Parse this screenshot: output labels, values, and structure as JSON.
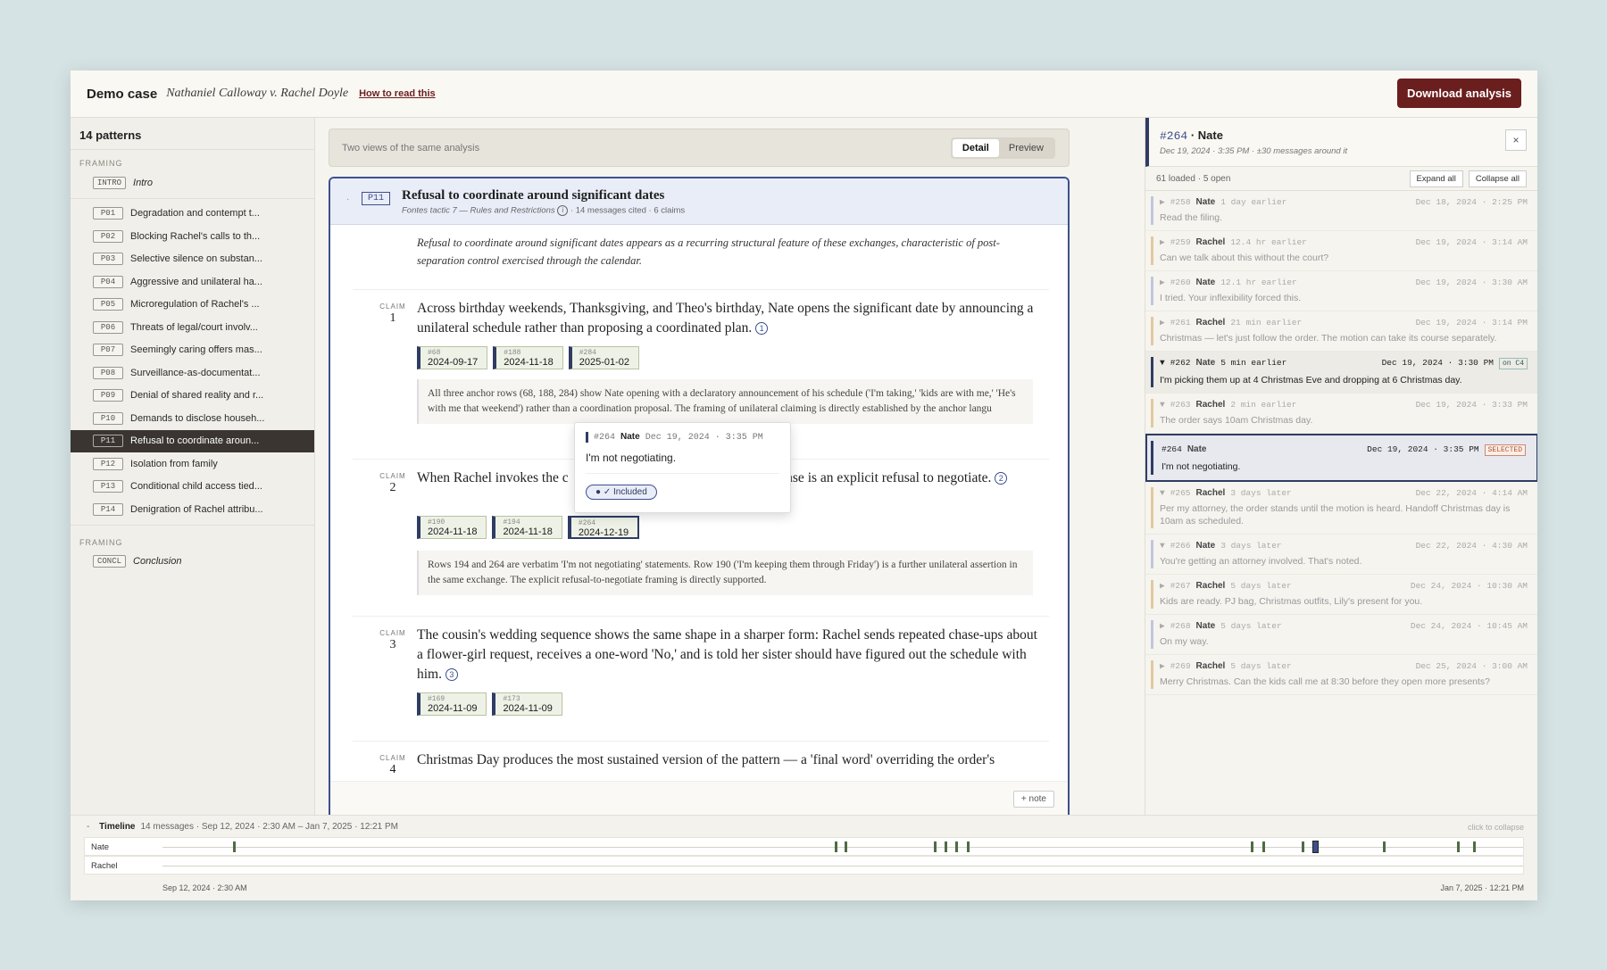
{
  "header": {
    "title": "Demo case",
    "case_name": "Nathaniel Calloway v. Rachel Doyle",
    "how_link": "How to read this",
    "download": "Download analysis"
  },
  "sidebar": {
    "count": "14 patterns",
    "section_top": "FRAMING",
    "section_bottom": "FRAMING",
    "intro": {
      "code": "INTRO",
      "label": "Intro"
    },
    "items": [
      {
        "code": "P01",
        "label": "Degradation and contempt t..."
      },
      {
        "code": "P02",
        "label": "Blocking Rachel's calls to th..."
      },
      {
        "code": "P03",
        "label": "Selective silence on substan..."
      },
      {
        "code": "P04",
        "label": "Aggressive and unilateral ha..."
      },
      {
        "code": "P05",
        "label": "Microregulation of Rachel's ..."
      },
      {
        "code": "P06",
        "label": "Threats of legal/court involv..."
      },
      {
        "code": "P07",
        "label": "Seemingly caring offers mas..."
      },
      {
        "code": "P08",
        "label": "Surveillance-as-documentat..."
      },
      {
        "code": "P09",
        "label": "Denial of shared reality and r..."
      },
      {
        "code": "P10",
        "label": "Demands to disclose househ..."
      },
      {
        "code": "P11",
        "label": "Refusal to coordinate aroun..."
      },
      {
        "code": "P12",
        "label": "Isolation from family"
      },
      {
        "code": "P13",
        "label": "Conditional child access tied..."
      },
      {
        "code": "P14",
        "label": "Denigration of Rachel attribu..."
      }
    ],
    "conclusion": {
      "code": "CONCL",
      "label": "Conclusion"
    }
  },
  "views": {
    "caption": "Two views of the same analysis",
    "detail": "Detail",
    "preview": "Preview"
  },
  "pattern": {
    "code": "P11",
    "title": "Refusal to coordinate around significant dates",
    "tactic": "Fontes tactic 7 — Rules and Restrictions",
    "stats": "· 14 messages cited · 6 claims",
    "intro": "Refusal to coordinate around significant dates appears as a recurring structural feature of these exchanges, characteristic of post-separation control exercised through the calendar.",
    "claim_label": "CLAIM",
    "add_note": "+ note",
    "claims": [
      {
        "num": "1",
        "text": "Across birthday weekends, Thanksgiving, and Theo's birthday, Nate opens the significant date by announcing a unilateral schedule rather than proposing a coordinated plan.",
        "marker": "1",
        "chips": [
          {
            "id": "#68",
            "date": "2024-09-17"
          },
          {
            "id": "#188",
            "date": "2024-11-18"
          },
          {
            "id": "#284",
            "date": "2025-01-02"
          }
        ],
        "note": "All three anchor rows (68, 188, 284) show Nate opening with a declaratory announcement of his schedule ('I'm taking,' 'kids are with me,' 'He's with me that weekend') rather than a coordination proposal. The framing of unilateral claiming is directly established by the anchor langu"
      },
      {
        "num": "2",
        "text_a": "When Rachel invokes the c",
        "text_b": "response is an explicit refusal to negotiate.",
        "marker": "2",
        "chips": [
          {
            "id": "#190",
            "date": "2024-11-18"
          },
          {
            "id": "#194",
            "date": "2024-11-18"
          },
          {
            "id": "#264",
            "date": "2024-12-19"
          }
        ],
        "note": "Rows 194 and 264 are verbatim 'I'm not negotiating' statements. Row 190 ('I'm keeping them through Friday') is a further unilateral assertion in the same exchange. The explicit refusal-to-negotiate framing is directly supported."
      },
      {
        "num": "3",
        "text": "The cousin's wedding sequence shows the same shape in a sharper form: Rachel sends repeated chase-ups about a flower-girl request, receives a one-word 'No,' and is told her sister should have figured out the schedule with him.",
        "marker": "3",
        "chips": [
          {
            "id": "#169",
            "date": "2024-11-09"
          },
          {
            "id": "#173",
            "date": "2024-11-09"
          }
        ]
      },
      {
        "num": "4",
        "text": "Christmas Day produces the most sustained version of the pattern — a 'final word' overriding the order's"
      }
    ]
  },
  "popover": {
    "id": "#264",
    "sender": "Nate",
    "ts": "Dec 19, 2024 · 3:35 PM",
    "text": "I'm not negotiating.",
    "status": "✓ Included"
  },
  "thread": {
    "id": "#264",
    "sender": "· Nate",
    "meta": "Dec 19, 2024 · 3:35 PM · ±30 messages around it",
    "close": "×",
    "loaded": "61 loaded · 5 open",
    "expand": "Expand all",
    "collapse": "Collapse all",
    "messages": [
      {
        "arrow": "▶",
        "id": "#258",
        "sender": "Nate",
        "rel": "1 day earlier",
        "ts": "Dec 18, 2024 · 2:25 PM",
        "text": "Read the filing.",
        "side": "n"
      },
      {
        "arrow": "▶",
        "id": "#259",
        "sender": "Rachel",
        "rel": "12.4 hr earlier",
        "ts": "Dec 19, 2024 · 3:14 AM",
        "text": "Can we talk about this without the court?",
        "side": "r"
      },
      {
        "arrow": "▶",
        "id": "#260",
        "sender": "Nate",
        "rel": "12.1 hr earlier",
        "ts": "Dec 19, 2024 · 3:30 AM",
        "text": "I tried. Your inflexibility forced this.",
        "side": "n"
      },
      {
        "arrow": "▶",
        "id": "#261",
        "sender": "Rachel",
        "rel": "21 min earlier",
        "ts": "Dec 19, 2024 · 3:14 PM",
        "text": "Christmas — let's just follow the order. The motion can take its course separately.",
        "side": "r"
      },
      {
        "arrow": "▼",
        "id": "#262",
        "sender": "Nate",
        "rel": "5 min earlier",
        "ts": "Dec 19, 2024 · 3:30 PM",
        "tag": "on C4",
        "text": "I'm picking them up at 4 Christmas Eve and dropping at 6 Christmas day.",
        "side": "n",
        "hi": true
      },
      {
        "arrow": "▼",
        "id": "#263",
        "sender": "Rachel",
        "rel": "2 min earlier",
        "ts": "Dec 19, 2024 · 3:33 PM",
        "text": "The order says 10am Christmas day.",
        "side": "r"
      },
      {
        "arrow": "",
        "id": "#264",
        "sender": "Nate",
        "rel": "",
        "ts": "Dec 19, 2024 · 3:35 PM",
        "tag": "SELECTED",
        "text": "I'm not negotiating.",
        "side": "n",
        "sel": true
      },
      {
        "arrow": "▼",
        "id": "#265",
        "sender": "Rachel",
        "rel": "3 days later",
        "ts": "Dec 22, 2024 · 4:14 AM",
        "text": "Per my attorney, the order stands until the motion is heard. Handoff Christmas day is 10am as scheduled.",
        "side": "r"
      },
      {
        "arrow": "▼",
        "id": "#266",
        "sender": "Nate",
        "rel": "3 days later",
        "ts": "Dec 22, 2024 · 4:30 AM",
        "text": "You're getting an attorney involved. That's noted.",
        "side": "n"
      },
      {
        "arrow": "▶",
        "id": "#267",
        "sender": "Rachel",
        "rel": "5 days later",
        "ts": "Dec 24, 2024 · 10:30 AM",
        "text": "Kids are ready. PJ bag, Christmas outfits, Lily's present for you.",
        "side": "r"
      },
      {
        "arrow": "▶",
        "id": "#268",
        "sender": "Nate",
        "rel": "5 days later",
        "ts": "Dec 24, 2024 · 10:45 AM",
        "text": "On my way.",
        "side": "n"
      },
      {
        "arrow": "▶",
        "id": "#269",
        "sender": "Rachel",
        "rel": "5 days later",
        "ts": "Dec 25, 2024 · 3:00 AM",
        "text": "Merry Christmas. Can the kids call me at 8:30 before they open more presents?",
        "side": "r"
      }
    ]
  },
  "timeline": {
    "title": "Timeline",
    "summary": "14 messages · Sep 12, 2024 · 2:30 AM – Jan 7, 2025 · 12:21 PM",
    "collapse_hint": "click to collapse",
    "lanes": [
      "Nate",
      "Rachel"
    ],
    "start_label": "Sep 12, 2024 · 2:30 AM",
    "end_label": "Jan 7, 2025 · 12:21 PM",
    "nate_ticks": [
      0.047,
      0.491,
      0.498,
      0.564,
      0.572,
      0.58,
      0.588,
      0.798,
      0.806,
      0.835,
      0.895,
      0.95,
      0.962
    ],
    "selected_tick": 0.843
  }
}
